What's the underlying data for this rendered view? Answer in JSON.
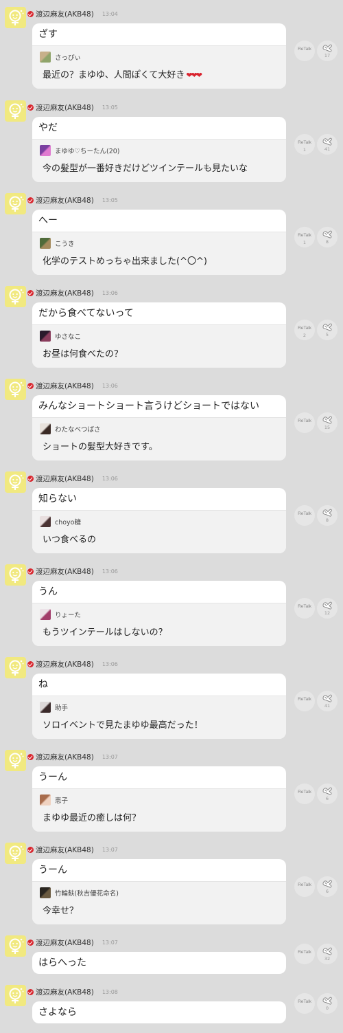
{
  "accent": {
    "verified": "#d8262e",
    "heart": "#d9232e",
    "avatar": "#f1e980"
  },
  "retalk_label": "ReTalk",
  "posts": [
    {
      "name": "渡辺麻友(AKB48)",
      "time": "13:04",
      "text": "ざす",
      "quote_user": "さっぴぃ",
      "quote_text": "最近の？まゆゆ、人間ぽくて大好き",
      "quote_hearts": "❤❤❤",
      "retalk_count": "",
      "like_count": "17"
    },
    {
      "name": "渡辺麻友(AKB48)",
      "time": "13:05",
      "text": "やだ",
      "quote_user": "まゆゆ♡ちーたん(20)",
      "quote_text": "今の髪型が一番好きだけどツインテールも見たいな",
      "retalk_count": "1",
      "like_count": "41"
    },
    {
      "name": "渡辺麻友(AKB48)",
      "time": "13:05",
      "text": "へー",
      "quote_user": "こうき",
      "quote_text": "化学のテストめっちゃ出来ました(^〇^)",
      "retalk_count": "1",
      "like_count": "8"
    },
    {
      "name": "渡辺麻友(AKB48)",
      "time": "13:06",
      "text": "だから食べてないって",
      "quote_user": "ゆさなこ",
      "quote_text": "お昼は何食べたの？",
      "retalk_count": "2",
      "like_count": "5"
    },
    {
      "name": "渡辺麻友(AKB48)",
      "time": "13:06",
      "text": "みんなショートショート言うけどショートではない",
      "quote_user": "わたなべつばさ",
      "quote_text": "ショートの髪型大好きです。",
      "retalk_count": "",
      "like_count": "15"
    },
    {
      "name": "渡辺麻友(AKB48)",
      "time": "13:06",
      "text": "知らない",
      "quote_user": "choyo糖",
      "quote_text": "いつ食べるの",
      "retalk_count": "",
      "like_count": "8"
    },
    {
      "name": "渡辺麻友(AKB48)",
      "time": "13:06",
      "text": "うん",
      "quote_user": "りょーた",
      "quote_text": "もうツインテールはしないの？",
      "retalk_count": "",
      "like_count": "12"
    },
    {
      "name": "渡辺麻友(AKB48)",
      "time": "13:06",
      "text": "ね",
      "quote_user": "助手",
      "quote_text": "ソロイベントで見たまゆゆ最高だった！",
      "retalk_count": "",
      "like_count": "41"
    },
    {
      "name": "渡辺麻友(AKB48)",
      "time": "13:07",
      "text": "うーん",
      "quote_user": "恵子",
      "quote_text": "まゆゆ最近の癒しは何？",
      "retalk_count": "",
      "like_count": "6"
    },
    {
      "name": "渡辺麻友(AKB48)",
      "time": "13:07",
      "text": "うーん",
      "quote_user": "竹輪麸(秋吉優花命名)",
      "quote_text": "今幸せ？",
      "retalk_count": "",
      "like_count": "6"
    },
    {
      "name": "渡辺麻友(AKB48)",
      "time": "13:07",
      "text": "はらへった",
      "retalk_count": "",
      "like_count": "32"
    },
    {
      "name": "渡辺麻友(AKB48)",
      "time": "13:08",
      "text": "さよなら",
      "retalk_count": "",
      "like_count": "0"
    }
  ]
}
